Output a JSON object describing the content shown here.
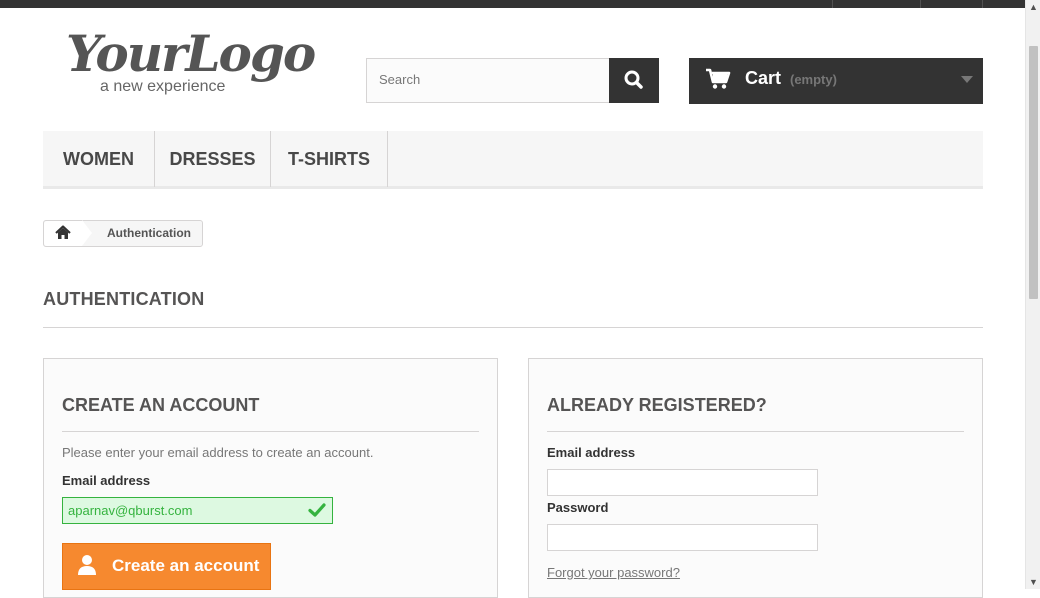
{
  "header": {
    "logo": {
      "main": "YourLogo",
      "tagline": "a new experience"
    },
    "search": {
      "placeholder": "Search",
      "button_icon": "search-icon"
    },
    "cart": {
      "label": "Cart",
      "quantity": "(empty)",
      "icon": "cart-icon"
    }
  },
  "nav": {
    "items": [
      {
        "label": "WOMEN"
      },
      {
        "label": "DRESSES"
      },
      {
        "label": "T-SHIRTS"
      }
    ]
  },
  "breadcrumb": {
    "home_icon": "home-icon",
    "current": "Authentication"
  },
  "page": {
    "title": "AUTHENTICATION"
  },
  "create_account": {
    "title": "CREATE AN ACCOUNT",
    "instructions": "Please enter your email address to create an account.",
    "email_label": "Email address",
    "email_value": "aparnav@qburst.com",
    "button_label": "Create an account",
    "button_icon": "user-icon"
  },
  "login": {
    "title": "ALREADY REGISTERED?",
    "email_label": "Email address",
    "email_value": "",
    "password_label": "Password",
    "password_value": "",
    "forgot_link": "Forgot your password?"
  },
  "colors": {
    "accent": "#f6892f",
    "dark": "#333333",
    "success": "#35b33f"
  }
}
